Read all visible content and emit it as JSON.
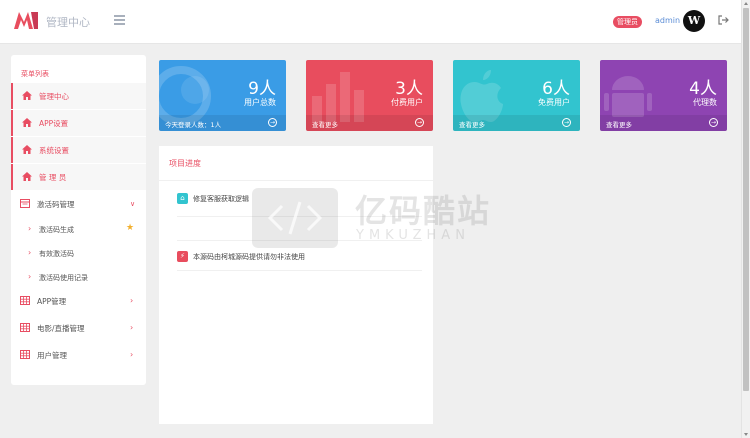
{
  "header": {
    "brand": "管理中心",
    "admin_badge": "管理员",
    "admin_name": "admin",
    "avatar_letter": "W"
  },
  "sidebar": {
    "title": "菜单列表",
    "items": [
      {
        "label": "管理中心",
        "icon": "home-icon",
        "style": "active"
      },
      {
        "label": "APP设置",
        "icon": "home-icon",
        "style": "active"
      },
      {
        "label": "系统设置",
        "icon": "home-icon",
        "style": "active"
      },
      {
        "label": "管 理 员",
        "icon": "home-icon",
        "style": "active"
      },
      {
        "label": "激活码管理",
        "icon": "calendar-icon",
        "style": "group",
        "expanded": true
      },
      {
        "label": "APP管理",
        "icon": "grid-icon",
        "style": "group"
      },
      {
        "label": "电影/直播管理",
        "icon": "grid-icon",
        "style": "group"
      },
      {
        "label": "用户管理",
        "icon": "grid-icon",
        "style": "group"
      }
    ],
    "subitems": [
      {
        "label": "激活码生成",
        "starred": true
      },
      {
        "label": "有效激活码"
      },
      {
        "label": "激活码使用记录"
      }
    ]
  },
  "cards": [
    {
      "number": "9人",
      "subtitle": "用户总数",
      "footer": "今天登录人数：1人",
      "color": "#3a9ce6"
    },
    {
      "number": "3人",
      "subtitle": "付费用户",
      "footer": "查看更多",
      "color": "#e84d5e"
    },
    {
      "number": "6人",
      "subtitle": "免费用户",
      "footer": "查看更多",
      "color": "#32c4cf"
    },
    {
      "number": "4人",
      "subtitle": "代理数",
      "footer": "查看更多",
      "color": "#8e44b2"
    }
  ],
  "panel": {
    "title": "项目进度",
    "rows": [
      {
        "text": "修复客服获取逻辑",
        "icon": "bell-icon",
        "color": "#32c4cf"
      },
      {
        "text": "本源码由柯城源码提供请勿非法使用",
        "icon": "bolt-icon",
        "color": "#e84d5e"
      }
    ]
  },
  "watermark": {
    "text": "亿码酷站",
    "sub": "YMKUZHAN"
  }
}
